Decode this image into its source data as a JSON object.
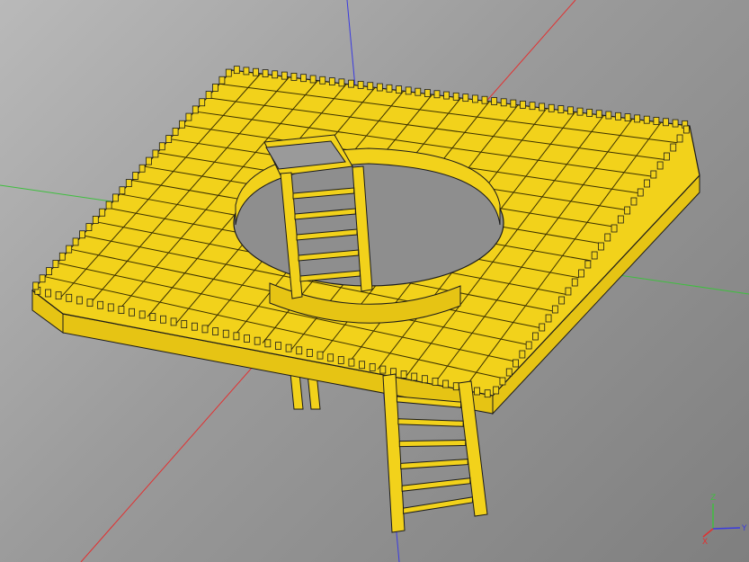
{
  "viewport": {
    "background_top": "#b9b9b9",
    "background_bottom": "#7f7f7f",
    "model_color": "#f2d21b",
    "model_edge_color": "#1a1a1a",
    "axis_colors": {
      "x": "#e23030",
      "y": "#3fbf3f",
      "z": "#3a3ae0"
    }
  },
  "triad": {
    "x_label": "X",
    "y_label": "Y",
    "z_label": "Z"
  }
}
